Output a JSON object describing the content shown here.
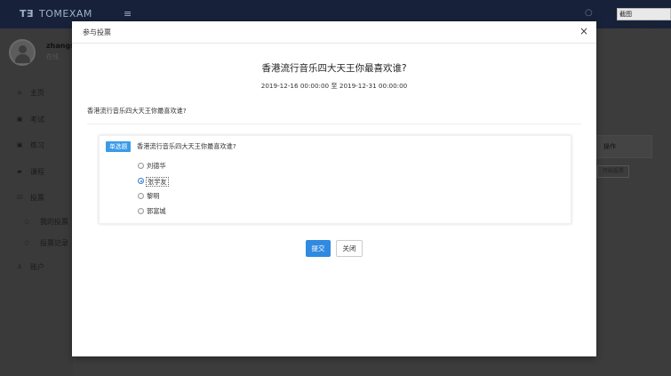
{
  "app": {
    "logo_mark": "T∃",
    "logo_text": "TOMEXAM",
    "hamburger": "≡",
    "capture_hint": "截图 Ctrl+Shift+"
  },
  "user": {
    "name": "zhangs",
    "status": "在线"
  },
  "sidebar": {
    "items": [
      {
        "icon": "home-icon",
        "glyph": "⌂",
        "label": "主页"
      },
      {
        "icon": "calendar-icon",
        "glyph": "▣",
        "label": "考试"
      },
      {
        "icon": "calendar-icon",
        "glyph": "▣",
        "label": "练习"
      },
      {
        "icon": "book-icon",
        "glyph": "▰",
        "label": "课程"
      },
      {
        "icon": "check-square-icon",
        "glyph": "☑",
        "label": "投票"
      },
      {
        "icon": "circle-icon",
        "glyph": "○",
        "label": "我的投票"
      },
      {
        "icon": "circle-icon",
        "glyph": "○",
        "label": "投票记录"
      },
      {
        "icon": "user-icon",
        "glyph": "♙",
        "label": "账户"
      }
    ]
  },
  "background_table": {
    "header": "操作",
    "button": "开始投票"
  },
  "modal": {
    "title": "参与投票",
    "close_glyph": "×",
    "vote_title": "香港流行音乐四大天王你最喜欢谁?",
    "dates": "2019-12-16 00:00:00 至 2019-12-31 00:00:00",
    "description": "香港流行音乐四大天王你最喜欢谁?",
    "question": {
      "type_badge": "单选题",
      "text": "香港流行音乐四大天王你最喜欢谁?",
      "options": [
        {
          "label": "刘德华",
          "selected": false
        },
        {
          "label": "张学友",
          "selected": true
        },
        {
          "label": "黎明",
          "selected": false
        },
        {
          "label": "郭富城",
          "selected": false
        }
      ]
    },
    "submit_label": "提交",
    "close_label": "关闭"
  },
  "colors": {
    "topbar": "#17223a",
    "primary_button": "#2f8ae0",
    "badge": "#3a9be8"
  }
}
